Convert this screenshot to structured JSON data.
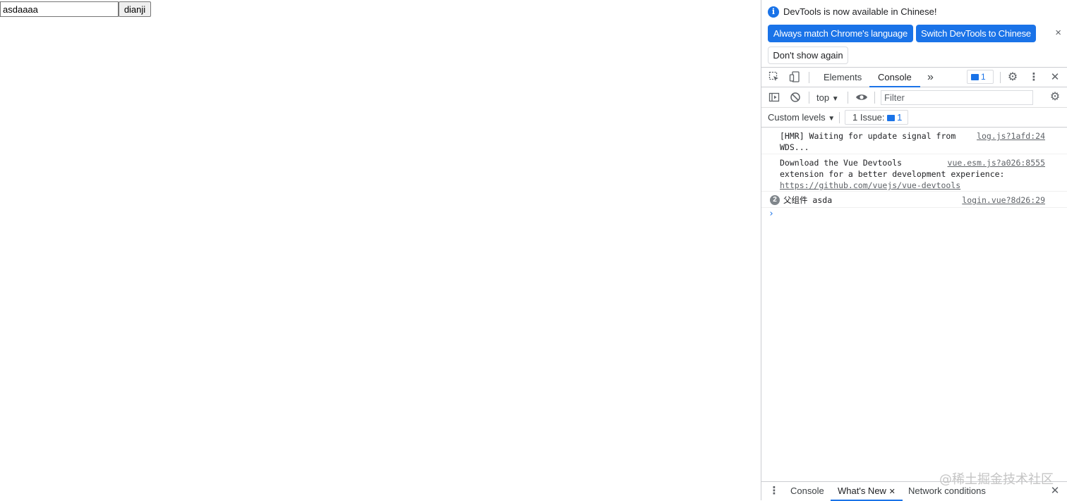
{
  "page": {
    "input_value": "asdaaaa",
    "button_label": "dianji"
  },
  "infobar": {
    "message": "DevTools is now available in Chinese!",
    "match_language": "Always match Chrome's language",
    "switch_language": "Switch DevTools to Chinese",
    "dont_show": "Don't show again",
    "close": "×"
  },
  "tabs": {
    "elements": "Elements",
    "console": "Console",
    "more": "»",
    "issues_count": "1"
  },
  "toolbar": {
    "context": "top",
    "filter_placeholder": "Filter"
  },
  "levelbar": {
    "levels": "Custom levels",
    "issues_label": "1 Issue:",
    "issues_count": "1"
  },
  "console": {
    "messages": [
      {
        "text": "[HMR] Waiting for update signal from\nWDS...",
        "source": "log.js?1afd:24"
      },
      {
        "text": "Download the Vue Devtools\nextension for a better development experience:",
        "link": "https://github.com/vuejs/vue-devtools",
        "source": "vue.esm.js?a026:8555"
      },
      {
        "text": "父组件 asda",
        "source": "login.vue?8d26:29",
        "repeat": "2"
      }
    ],
    "prompt": "›"
  },
  "drawer": {
    "tabs": [
      "Console",
      "What's New",
      "Network conditions"
    ],
    "close_tab": "✕",
    "close": "✕"
  },
  "watermark": "@稀土掘金技术社区",
  "colors": {
    "accent": "#1a73e8",
    "border": "#cbcdd1"
  }
}
